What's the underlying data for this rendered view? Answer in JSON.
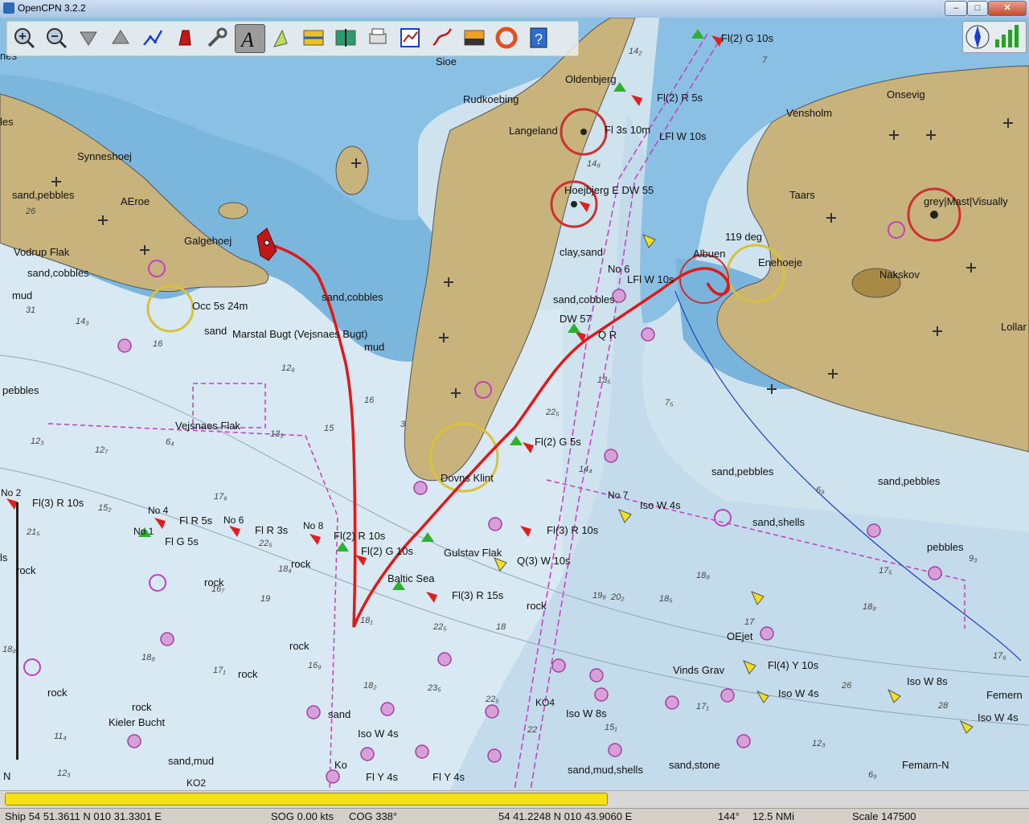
{
  "window": {
    "title": "OpenCPN 3.2.2"
  },
  "toolbar": {
    "buttons": [
      {
        "icon": "zoom-in-icon"
      },
      {
        "icon": "zoom-out-icon"
      },
      {
        "icon": "scale-in-icon"
      },
      {
        "icon": "scale-out-icon"
      },
      {
        "icon": "route-icon"
      },
      {
        "icon": "ship-icon"
      },
      {
        "icon": "settings-icon"
      },
      {
        "icon": "text-icon"
      },
      {
        "icon": "ais-icon"
      },
      {
        "icon": "current-icon"
      },
      {
        "icon": "tide-icon"
      },
      {
        "icon": "print-icon"
      },
      {
        "icon": "route-manager-icon"
      },
      {
        "icon": "track-icon"
      },
      {
        "icon": "color-scheme-icon"
      },
      {
        "icon": "mob-icon"
      },
      {
        "icon": "help-icon"
      }
    ]
  },
  "chart_labels": [
    "Sioe",
    "Rudkoebing",
    "Oldenbjerg",
    "Langeland",
    "Onsevig",
    "Vensholm",
    "Synneshoej",
    "AEroe",
    "sand,pebbles",
    "Galgehoej",
    "Vodrup Flak",
    "sand,cobbles",
    "mud",
    "Occ 5s 24m",
    "sand",
    "Marstal Bugt (Vejsnaes Bugt)",
    "sand,cobbles",
    "mud",
    "pebbles",
    "Vejsnaes Flak",
    "Dovns Klint",
    "Fl(2) G 5s",
    "Fl(2) R 5s",
    "Fl 3s 10m",
    "LFl W 10s",
    "Hoejbjerg E DW 55",
    "clay,sand",
    "No 6",
    "LFl W 10s",
    "sand,cobbles",
    "DW 57",
    "Q R",
    "Albuen",
    "119 deg",
    "Enehoeje",
    "Nakskov",
    "Taars",
    "grey|Mast|Visually",
    "Lollar",
    "Fl(2) G 10s",
    "No 2",
    "Fl(3) R 10s",
    "No 4",
    "Fl R 5s",
    "No 6",
    "No 1",
    "Fl G 5s",
    "Fl R 3s",
    "No 8",
    "Fl(2) R 10s",
    "Fl(2) G 10s",
    "Baltic Sea",
    "Fl(3) R 15s",
    "Gulstav Flak",
    "Q(3) W 10s",
    "Fl(3) R 10s",
    "No 7",
    "Iso W 4s",
    "sand,pebbles",
    "sand,pebbles",
    "sand,shells",
    "pebbles",
    "rock",
    "rock",
    "rock",
    "rock",
    "rock",
    "rock",
    "rock",
    "rock",
    "Kieler Bucht",
    "sand,mud",
    "sand",
    "Iso W 4s",
    "KO4",
    "Iso W 8s",
    "sand,mud,shells",
    "sand,stone",
    "OEjet",
    "Vinds Grav",
    "Fl(4) Y 10s",
    "Iso W 4s",
    "Iso W 8s",
    "Femern",
    "Iso W 4s",
    "Femarn-N",
    "KO2",
    "Fl Y 4s",
    "Fl Y 4s",
    "les",
    "nes",
    "ls",
    "N",
    "Ko"
  ],
  "progress": {
    "fraction": 0.59
  },
  "status": {
    "ship": "Ship 54 51.3611 N   010 31.3301 E",
    "sog": "SOG 0.00 kts",
    "cog": "COG 338°",
    "cursor": "54 41.2248 N   010 43.9060 E",
    "bearing": "144°",
    "distance": "12.5 NMi",
    "scale": "Scale 147500"
  }
}
